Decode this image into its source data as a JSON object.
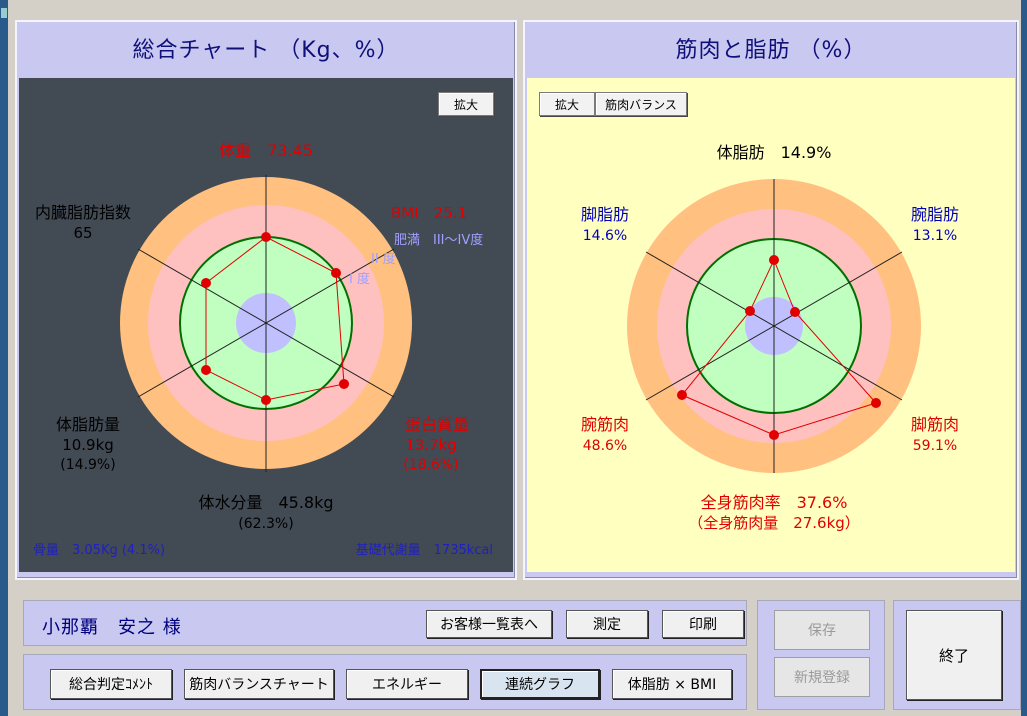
{
  "left": {
    "title": "総合チャート （Kg、%）",
    "expand_label": "拡大",
    "weight": "体重　73.45",
    "bmi": "BMI　25.1",
    "obesity_levels": [
      "肥満　III～IV度",
      "II 度",
      "I 度"
    ],
    "visceral_label": "内臓脂肪指数",
    "visceral_value": "65",
    "fat_mass_label": "体脂肪量",
    "fat_mass_value": "10.9kg",
    "fat_mass_pct": "(14.9%)",
    "protein_label": "蛋白質量",
    "protein_value": "13.7kg",
    "protein_pct": "(18.6%)",
    "water": "体水分量　45.8kg",
    "water_pct": "(62.3%)",
    "bone": "骨量　3.05Kg (4.1%)",
    "bmr": "基礎代謝量　1735kcal",
    "colors": {
      "bg": "#424a54",
      "outer": "#ffc080",
      "middle": "#ffc0c0",
      "inner": "#c0ffc0",
      "core": "#c0c0ff",
      "line": "#e00000",
      "ring": "#007000"
    }
  },
  "right": {
    "title": "筋肉と脂肪 （%）",
    "expand_label": "拡大",
    "balance_label": "筋肉バランス",
    "body_fat": "体脂肪　14.9%",
    "leg_fat_label": "脚脂肪",
    "leg_fat_value": "14.6%",
    "arm_fat_label": "腕脂肪",
    "arm_fat_value": "13.1%",
    "arm_muscle_label": "腕筋肉",
    "arm_muscle_value": "48.6%",
    "leg_muscle_label": "脚筋肉",
    "leg_muscle_value": "59.1%",
    "total_muscle_rate": "全身筋肉率　37.6%",
    "total_muscle_mass": "（全身筋肉量　27.6kg）",
    "colors": {
      "bg": "#ffffc0"
    }
  },
  "customer": {
    "name": "小那覇　安之 様"
  },
  "top_buttons": {
    "list": "お客様一覧表へ",
    "measure": "測定",
    "print": "印刷"
  },
  "bottom_buttons": {
    "comment": "総合判定ｺﾒﾝﾄ",
    "balance_chart": "筋肉バランスチャート",
    "energy": "エネルギー",
    "continuous": "連続グラフ",
    "fat_bmi": "体脂肪 × BMI"
  },
  "side_buttons": {
    "save": "保存",
    "register": "新規登録",
    "exit": "終了"
  }
}
